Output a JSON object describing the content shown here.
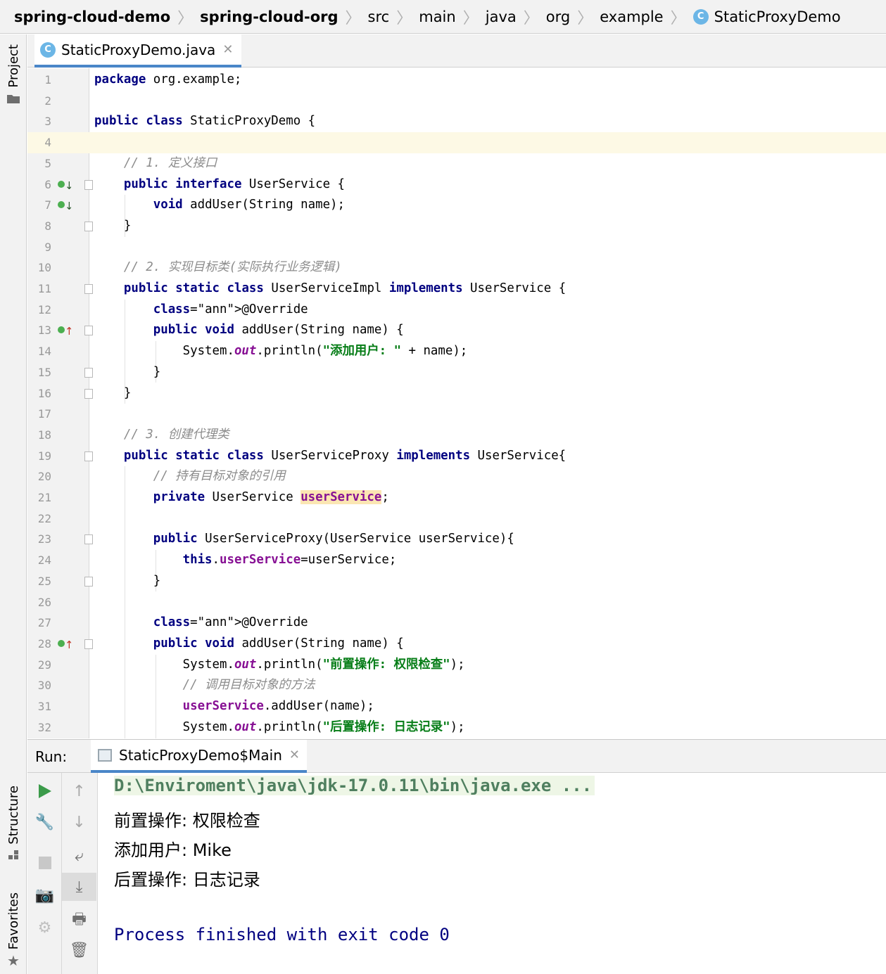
{
  "breadcrumb": [
    "spring-cloud-demo",
    "spring-cloud-org",
    "src",
    "main",
    "java",
    "org",
    "example",
    "StaticProxyDemo"
  ],
  "left_strip": {
    "project": "Project",
    "structure": "Structure",
    "favorites": "Favorites"
  },
  "editor_tab": {
    "label": "StaticProxyDemo.java",
    "close": "✕"
  },
  "class_icon_letter": "C",
  "editor": {
    "current_line": 4,
    "lines": [
      {
        "n": "1",
        "text": "package org.example;"
      },
      {
        "n": "2",
        "text": ""
      },
      {
        "n": "3",
        "text": "public class StaticProxyDemo {"
      },
      {
        "n": "4",
        "text": ""
      },
      {
        "n": "5",
        "text": "    // 1. 定义接口"
      },
      {
        "n": "6",
        "text": "    public interface UserService {"
      },
      {
        "n": "7",
        "text": "        void addUser(String name);"
      },
      {
        "n": "8",
        "text": "    }"
      },
      {
        "n": "9",
        "text": ""
      },
      {
        "n": "10",
        "text": "    // 2. 实现目标类(实际执行业务逻辑)"
      },
      {
        "n": "11",
        "text": "    public static class UserServiceImpl implements UserService {"
      },
      {
        "n": "12",
        "text": "        @Override"
      },
      {
        "n": "13",
        "text": "        public void addUser(String name) {"
      },
      {
        "n": "14",
        "text": "            System.out.println(\"添加用户: \" + name);"
      },
      {
        "n": "15",
        "text": "        }"
      },
      {
        "n": "16",
        "text": "    }"
      },
      {
        "n": "17",
        "text": ""
      },
      {
        "n": "18",
        "text": "    // 3. 创建代理类"
      },
      {
        "n": "19",
        "text": "    public static class UserServiceProxy implements UserService{"
      },
      {
        "n": "20",
        "text": "        // 持有目标对象的引用"
      },
      {
        "n": "21",
        "text": "        private UserService userService;"
      },
      {
        "n": "22",
        "text": ""
      },
      {
        "n": "23",
        "text": "        public UserServiceProxy(UserService userService){"
      },
      {
        "n": "24",
        "text": "            this.userService=userService;"
      },
      {
        "n": "25",
        "text": "        }"
      },
      {
        "n": "26",
        "text": ""
      },
      {
        "n": "27",
        "text": "        @Override"
      },
      {
        "n": "28",
        "text": "        public void addUser(String name) {"
      },
      {
        "n": "29",
        "text": "            System.out.println(\"前置操作: 权限检查\");"
      },
      {
        "n": "30",
        "text": "            // 调用目标对象的方法"
      },
      {
        "n": "31",
        "text": "            userService.addUser(name);"
      },
      {
        "n": "32",
        "text": "            System.out.println(\"后置操作: 日志记录\");"
      }
    ]
  },
  "run": {
    "label": "Run:",
    "tab_label": "StaticProxyDemo$Main",
    "tab_close": "✕",
    "output": [
      "D:\\Enviroment\\java\\jdk-17.0.11\\bin\\java.exe ...",
      "前置操作: 权限检查",
      "添加用户: Mike",
      "后置操作: 日志记录",
      "",
      "Process finished with exit code 0"
    ]
  },
  "colors": {
    "keyword": "#000080",
    "comment": "#8c8c8c",
    "string": "#067d17",
    "annotation": "#808000",
    "field": "#871094",
    "current_line": "#fdf9e5",
    "tab_underline": "#4a86c8"
  }
}
